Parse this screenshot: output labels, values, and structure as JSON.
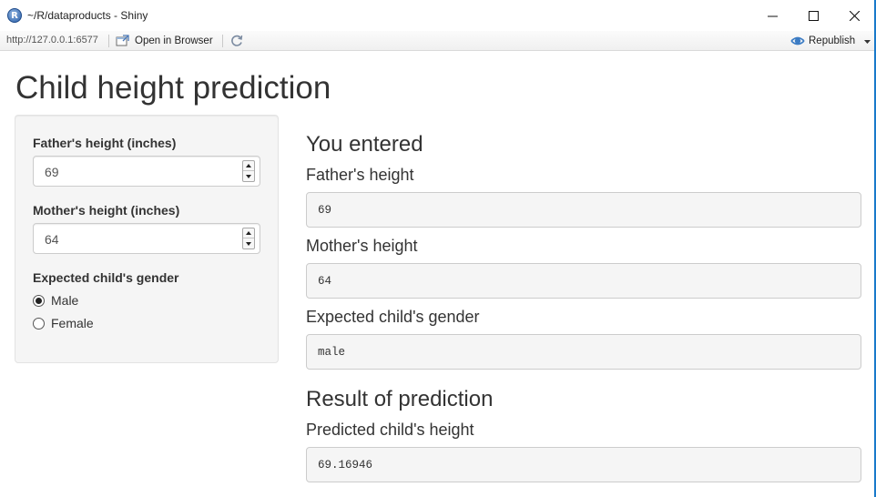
{
  "window": {
    "title": "~/R/dataproducts - Shiny",
    "logo_letter": "R"
  },
  "toolbar": {
    "url": "http://127.0.0.1:6577",
    "open_in_browser": "Open in Browser",
    "republish": "Republish"
  },
  "page": {
    "title": "Child height prediction"
  },
  "sidebar": {
    "father_label": "Father's height (inches)",
    "father_value": "69",
    "mother_label": "Mother's height (inches)",
    "mother_value": "64",
    "gender_label": "Expected child's gender",
    "gender_options": [
      "Male",
      "Female"
    ],
    "gender_selected": "Male"
  },
  "main": {
    "entered_heading": "You entered",
    "father_heading": "Father's height",
    "father_output": "69",
    "mother_heading": "Mother's height",
    "mother_output": "64",
    "gender_heading": "Expected child's gender",
    "gender_output": "male",
    "result_heading": "Result of prediction",
    "predicted_heading": "Predicted child's height",
    "predicted_output": "69.16946"
  }
}
